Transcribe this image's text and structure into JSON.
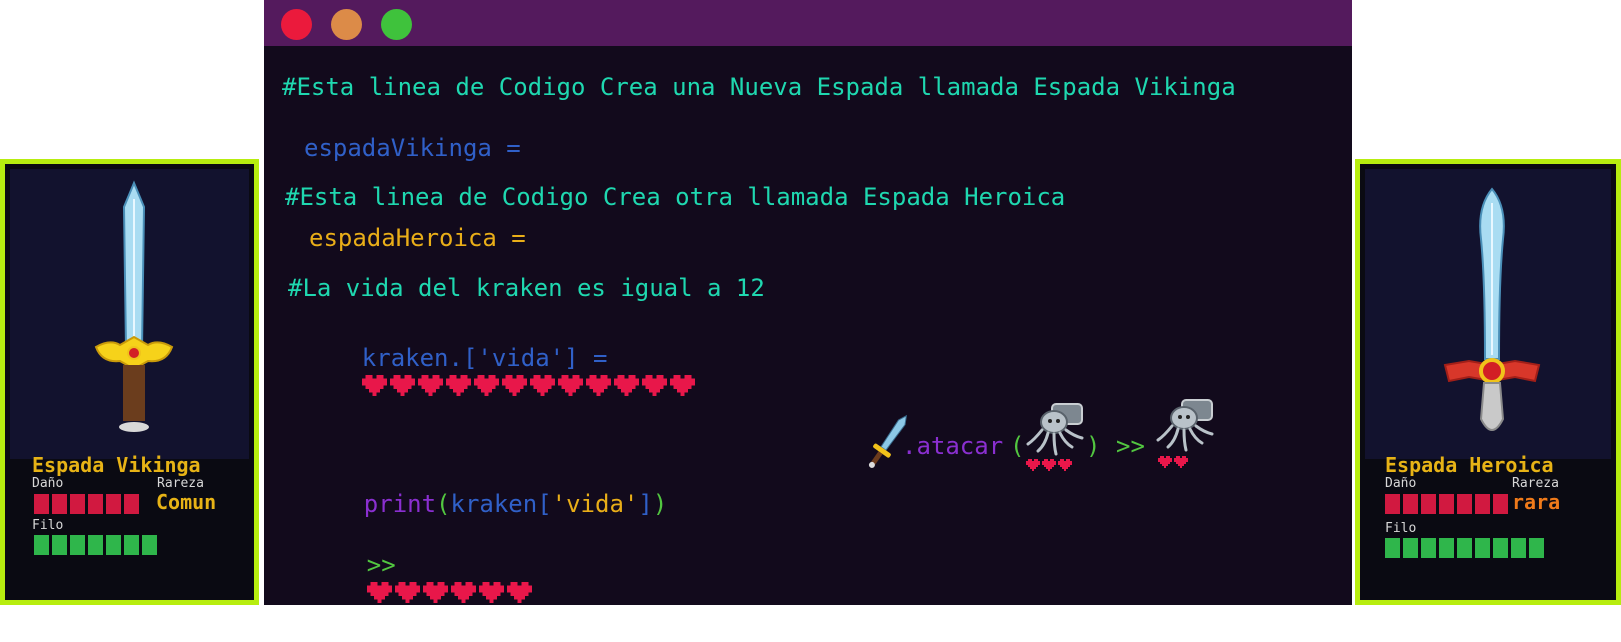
{
  "window": {
    "buttons": {
      "close": "red",
      "minimize": "orange",
      "maximize": "green"
    }
  },
  "code": {
    "comment1": "#Esta linea de Codigo Crea una Nueva Espada llamada Espada Vikinga",
    "assign1": "espadaVikinga =",
    "comment2": "#Esta linea de Codigo Crea otra llamada Espada Heroica",
    "assign2": "espadaHeroica =",
    "comment3": "#La vida del kraken es igual a 12",
    "assign3": "kraken.['vida'] =",
    "kraken_life_hearts": 12,
    "print_fn": "print",
    "print_open": "(",
    "print_arg": "kraken[",
    "print_key": "'vida'",
    "print_close_bracket": "]",
    "print_close": ")",
    "output_prompt": ">>",
    "output_hearts": 6
  },
  "attack": {
    "method": ".atacar",
    "open": "(",
    "close": ")",
    "arrow": ">>",
    "kraken_hearts_before": 3,
    "kraken_hearts_after": 2
  },
  "cards": [
    {
      "name": "Espada Vikinga",
      "damage_label": "Daño",
      "damage": 6,
      "rarity_label": "Rareza",
      "rarity": "Comun",
      "rarity_color": "#e7b316",
      "edge_label": "Filo",
      "edge": 7
    },
    {
      "name": "Espada Heroica",
      "damage_label": "Daño",
      "damage": 7,
      "rarity_label": "Rareza",
      "rarity": "rara",
      "rarity_color": "#ef7a1a",
      "edge_label": "Filo",
      "edge": 9
    }
  ],
  "colors": {
    "heart": "#e8174a",
    "title_bar": "#541a5d",
    "card_border": "#b7ed0f",
    "comment": "#1fd8b0"
  }
}
